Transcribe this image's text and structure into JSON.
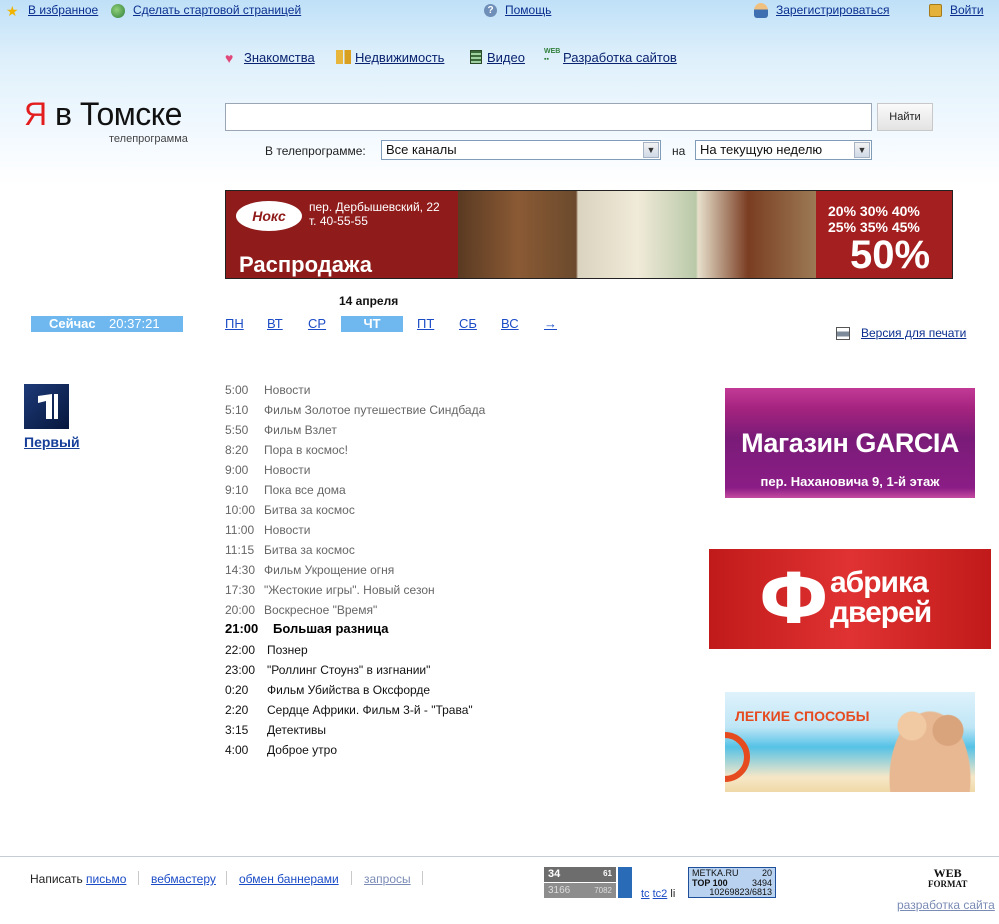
{
  "header": {
    "top_links": {
      "favorites": "В избранное",
      "homepage": "Сделать стартовой страницей",
      "help": "Помощь",
      "register": "Зарегистрироваться",
      "login": "Войти"
    },
    "nav": [
      {
        "label": "Знакомства",
        "icon": "heart-icon"
      },
      {
        "label": "Недвижимость",
        "icon": "buildings-icon"
      },
      {
        "label": "Видео",
        "icon": "film-icon"
      },
      {
        "label": "Разработка сайтов",
        "icon": "web-icon"
      }
    ],
    "logo": {
      "ya": "Я",
      "rest": "в Томске",
      "subtitle": "телепрограмма"
    }
  },
  "search": {
    "input_value": "",
    "button_label": "Найти",
    "filter_label": "В телепрограмме:",
    "channel_select": "Все каналы",
    "on_label": "на",
    "period_select": "На текущую неделю"
  },
  "banner_top": {
    "logo_text": "Нокс",
    "address": "пер. Дербышевский, 22",
    "phone": "т. 40-55-55",
    "sale": "Распродажа",
    "percents_row1": "20% 30% 40%",
    "percents_row2": "25% 35% 45%",
    "big_percent": "50%"
  },
  "schedule": {
    "date": "14 апреля",
    "now_label": "Сейчас",
    "now_time": "20:37:21",
    "days": [
      "ПН",
      "ВТ",
      "СР",
      "ЧТ",
      "ПТ",
      "СБ",
      "ВС",
      "→"
    ],
    "active_day": "ЧТ",
    "print_link": "Версия для печати",
    "channel": {
      "name": "Первый",
      "logo_icon": "channel-one-logo-icon"
    },
    "programs": [
      {
        "time": "5:00",
        "title": "Новости",
        "state": "past"
      },
      {
        "time": "5:10",
        "title": "Фильм  Золотое путешествие Синдбада",
        "state": "past"
      },
      {
        "time": "5:50",
        "title": "Фильм  Взлет",
        "state": "past"
      },
      {
        "time": "8:20",
        "title": "Пора в космос!",
        "state": "past"
      },
      {
        "time": "9:00",
        "title": "Новости",
        "state": "past"
      },
      {
        "time": "9:10",
        "title": "Пока все дома",
        "state": "past"
      },
      {
        "time": "10:00",
        "title": "Битва за космос",
        "state": "past"
      },
      {
        "time": "11:00",
        "title": "Новости",
        "state": "past"
      },
      {
        "time": "11:15",
        "title": "Битва за космос",
        "state": "past"
      },
      {
        "time": "14:30",
        "title": "Фильм  Укрощение огня",
        "state": "past"
      },
      {
        "time": "17:30",
        "title": "\"Жестокие игры\". Новый сезон",
        "state": "past"
      },
      {
        "time": "20:00",
        "title": "Воскресное \"Время\"",
        "state": "past"
      },
      {
        "time": "21:00",
        "title": "Большая разница",
        "state": "current"
      },
      {
        "time": "22:00",
        "title": "Познер",
        "state": "future"
      },
      {
        "time": "23:00",
        "title": "\"Роллинг Стоунз\" в изгнании\"",
        "state": "future"
      },
      {
        "time": "0:20",
        "title": "Фильм  Убийства в Оксфорде",
        "state": "future"
      },
      {
        "time": "2:20",
        "title": "Сердце Африки. Фильм 3-й - \"Трава\"",
        "state": "future"
      },
      {
        "time": "3:15",
        "title": "Детективы",
        "state": "future"
      },
      {
        "time": "4:00",
        "title": "Доброе утро",
        "state": "future"
      }
    ]
  },
  "ads": {
    "garcia": {
      "title": "Магазин GARCIA",
      "address": "пер. Нахановича 9, 1-й этаж"
    },
    "doors": {
      "letter": "Ф",
      "line1": "абрика",
      "line2": "дверей"
    },
    "beach": {
      "title": "ЛЕГКИЕ СПОСОБЫ"
    }
  },
  "footer": {
    "write_label": "Написать",
    "write_link": "письмо",
    "links": [
      "вебмастеру",
      "обмен баннерами",
      "запросы"
    ],
    "counter1": {
      "a": "34",
      "b": "61",
      "c": "3166",
      "d": "7082"
    },
    "tc_links": [
      "tc",
      "tc2"
    ],
    "li": "li",
    "counter2": {
      "brand": "METKA.RU",
      "brand_val": "20",
      "top": "TOP 100",
      "top_val": "3494",
      "total": "10269823/6813"
    },
    "webformat_logo": "WEB",
    "webformat_sub": "FORMAT",
    "dev_link": "разработка сайта"
  }
}
